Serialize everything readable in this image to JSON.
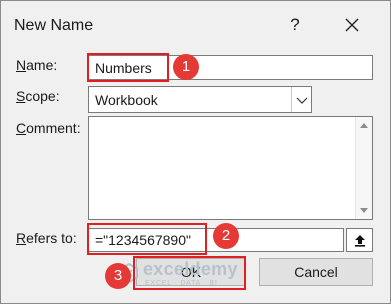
{
  "dialog": {
    "title": "New Name",
    "help_label": "?"
  },
  "form": {
    "name_label_key": "N",
    "name_label_rest": "ame:",
    "name_value": "Numbers",
    "scope_label_key": "S",
    "scope_label_rest": "cope:",
    "scope_value": "Workbook",
    "comment_label_key": "C",
    "comment_label_rest": "omment:",
    "comment_value": "",
    "refers_label_key": "R",
    "refers_label_rest": "efers to:",
    "refers_value": "=\"1234567890\""
  },
  "buttons": {
    "ok_label": "OK",
    "cancel_label": "Cancel"
  },
  "annotations": {
    "badge_1": "1",
    "badge_2": "2",
    "badge_3": "3",
    "highlight_color": "#e02020",
    "badge_color": "#e53935"
  },
  "watermark": {
    "name": "exceldemy",
    "tagline": "EXCEL · DATA · BI"
  }
}
